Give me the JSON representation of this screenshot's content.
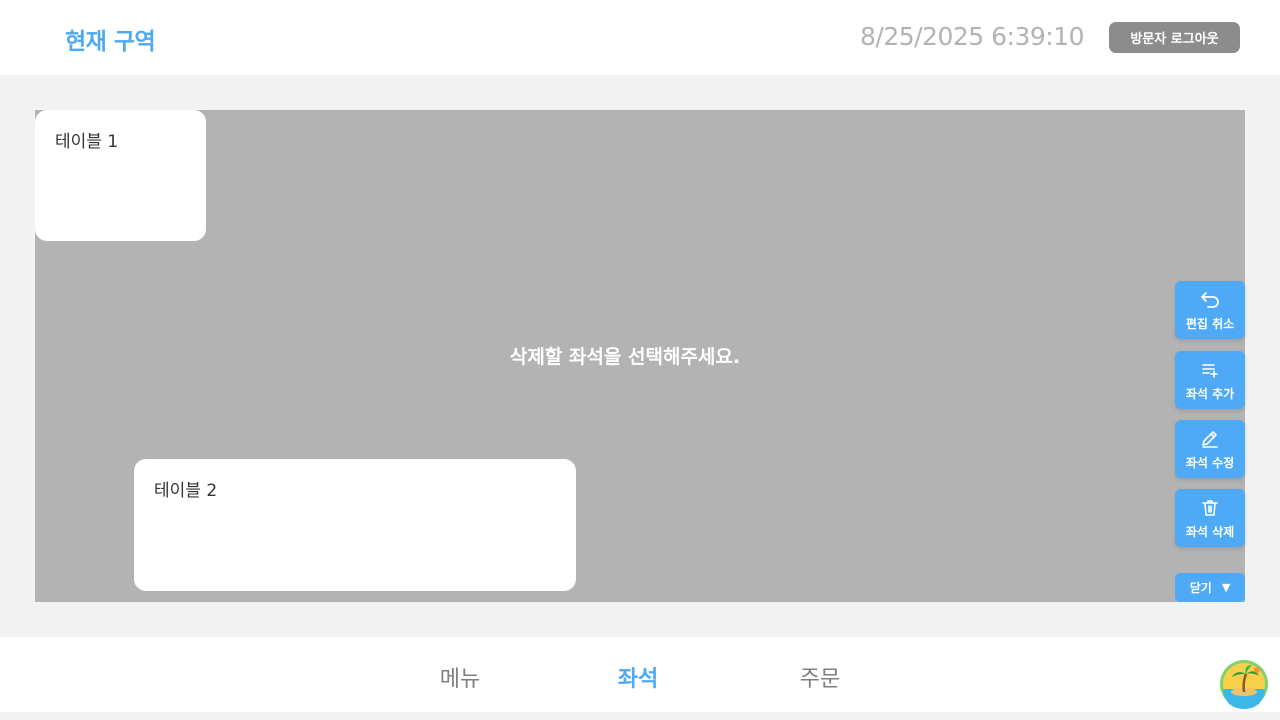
{
  "header": {
    "title": "현재 구역",
    "datetime": "8/25/2025 6:39:10",
    "logout_label": "방문자 로그아웃"
  },
  "canvas": {
    "instruction": "삭제할 좌석을 선택해주세요.",
    "tables": [
      {
        "name": "테이블 1"
      },
      {
        "name": "테이블 2"
      }
    ]
  },
  "toolbar": {
    "cancel_edit": {
      "label": "편집 취소",
      "icon": "undo-icon"
    },
    "add_seat": {
      "label": "좌석 추가",
      "icon": "list-add-icon"
    },
    "edit_seat": {
      "label": "좌석 수정",
      "icon": "pencil-icon"
    },
    "delete_seat": {
      "label": "좌석 삭제",
      "icon": "trash-icon"
    },
    "close": {
      "label": "닫기",
      "icon": "triangle-down-icon"
    }
  },
  "bottom_nav": {
    "tabs": [
      {
        "label": "메뉴",
        "active": false
      },
      {
        "label": "좌석",
        "active": true
      },
      {
        "label": "주문",
        "active": false
      }
    ]
  },
  "colors": {
    "accent": "#4ea9f1",
    "button": "#4eaaf6",
    "canvas": "#b3b3b3",
    "logout": "#8c8c8c"
  }
}
